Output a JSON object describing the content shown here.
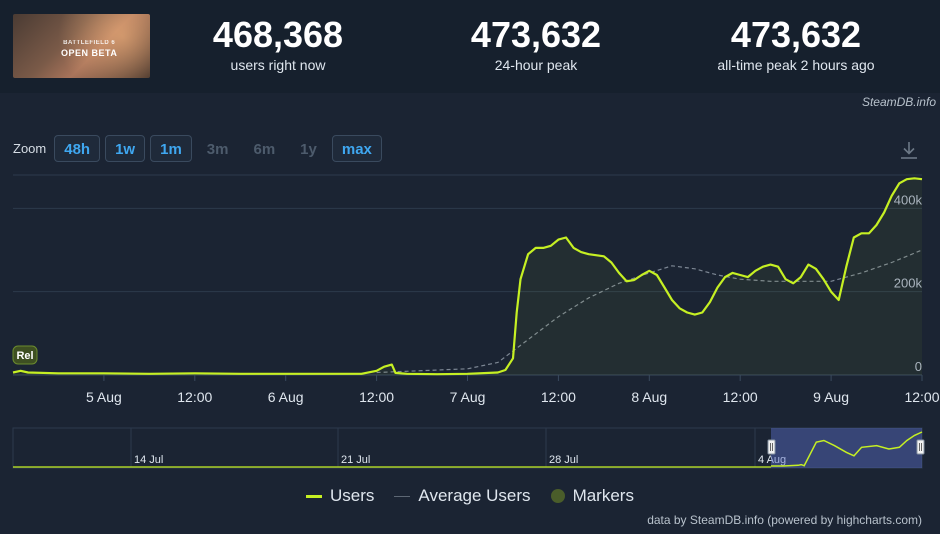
{
  "header": {
    "banner": {
      "line1": "BATTLEFIELD 6",
      "line2": "OPEN BETA"
    },
    "stats": [
      {
        "value": "468,368",
        "label": "users right now"
      },
      {
        "value": "473,632",
        "label": "24-hour peak"
      },
      {
        "value": "473,632",
        "label": "all-time peak 2 hours ago"
      }
    ],
    "credit": "SteamDB.info"
  },
  "zoom": {
    "label": "Zoom",
    "buttons": [
      {
        "label": "48h",
        "enabled": true
      },
      {
        "label": "1w",
        "enabled": true
      },
      {
        "label": "1m",
        "enabled": true
      },
      {
        "label": "3m",
        "enabled": false
      },
      {
        "label": "6m",
        "enabled": false
      },
      {
        "label": "1y",
        "enabled": false
      },
      {
        "label": "max",
        "enabled": true
      }
    ]
  },
  "icons": {
    "download": "download-icon"
  },
  "colors": {
    "users": "#c6f023",
    "average": "#7d8794",
    "markers": "#4a5d2a"
  },
  "chart_data": {
    "type": "line",
    "title": "",
    "x_unit": "hours since 4 Aug 00:00 UTC",
    "x_range": [
      12,
      132
    ],
    "x_ticks": [
      {
        "x": 24,
        "label": "5 Aug"
      },
      {
        "x": 36,
        "label": "12:00"
      },
      {
        "x": 48,
        "label": "6 Aug"
      },
      {
        "x": 60,
        "label": "12:00"
      },
      {
        "x": 72,
        "label": "7 Aug"
      },
      {
        "x": 84,
        "label": "12:00"
      },
      {
        "x": 96,
        "label": "8 Aug"
      },
      {
        "x": 108,
        "label": "12:00"
      },
      {
        "x": 120,
        "label": "9 Aug"
      },
      {
        "x": 132,
        "label": "12:00"
      }
    ],
    "y_range": [
      0,
      480000
    ],
    "y_ticks": [
      {
        "value": 0,
        "label": "0"
      },
      {
        "value": 200000,
        "label": "200k"
      },
      {
        "value": 400000,
        "label": "400k"
      }
    ],
    "grid": true,
    "legend_position": "bottom-center",
    "series": [
      {
        "name": "Users",
        "color": "#c6f023",
        "points": [
          [
            12,
            6000
          ],
          [
            13,
            10000
          ],
          [
            14,
            6000
          ],
          [
            18,
            4000
          ],
          [
            24,
            4000
          ],
          [
            30,
            3000
          ],
          [
            36,
            4000
          ],
          [
            42,
            3000
          ],
          [
            48,
            3000
          ],
          [
            54,
            3000
          ],
          [
            58,
            3000
          ],
          [
            60,
            10000
          ],
          [
            61,
            20000
          ],
          [
            62,
            25000
          ],
          [
            62.5,
            5000
          ],
          [
            64,
            3000
          ],
          [
            68,
            2000
          ],
          [
            72,
            3000
          ],
          [
            76,
            6000
          ],
          [
            77,
            12000
          ],
          [
            78,
            40000
          ],
          [
            78.5,
            150000
          ],
          [
            79,
            230000
          ],
          [
            80,
            290000
          ],
          [
            81,
            305000
          ],
          [
            82,
            305000
          ],
          [
            83,
            310000
          ],
          [
            84,
            325000
          ],
          [
            85,
            330000
          ],
          [
            86,
            305000
          ],
          [
            87,
            295000
          ],
          [
            88,
            290000
          ],
          [
            90,
            285000
          ],
          [
            91,
            270000
          ],
          [
            92,
            245000
          ],
          [
            93,
            225000
          ],
          [
            94,
            228000
          ],
          [
            95,
            240000
          ],
          [
            96,
            250000
          ],
          [
            97,
            240000
          ],
          [
            98,
            210000
          ],
          [
            99,
            180000
          ],
          [
            100,
            160000
          ],
          [
            101,
            150000
          ],
          [
            102,
            145000
          ],
          [
            103,
            150000
          ],
          [
            104,
            175000
          ],
          [
            105,
            210000
          ],
          [
            106,
            235000
          ],
          [
            107,
            245000
          ],
          [
            108,
            240000
          ],
          [
            109,
            235000
          ],
          [
            110,
            250000
          ],
          [
            111,
            260000
          ],
          [
            112,
            265000
          ],
          [
            113,
            260000
          ],
          [
            114,
            230000
          ],
          [
            115,
            220000
          ],
          [
            116,
            235000
          ],
          [
            117,
            265000
          ],
          [
            118,
            255000
          ],
          [
            119,
            230000
          ],
          [
            120,
            200000
          ],
          [
            121,
            180000
          ],
          [
            122,
            260000
          ],
          [
            123,
            330000
          ],
          [
            124,
            340000
          ],
          [
            125,
            340000
          ],
          [
            126,
            360000
          ],
          [
            127,
            390000
          ],
          [
            128,
            430000
          ],
          [
            129,
            460000
          ],
          [
            130,
            470000
          ],
          [
            131,
            472000
          ],
          [
            132,
            470000
          ]
        ]
      },
      {
        "name": "Average Users",
        "color": "#7d8794",
        "points": [
          [
            60,
            6000
          ],
          [
            72,
            15000
          ],
          [
            76,
            30000
          ],
          [
            80,
            85000
          ],
          [
            84,
            140000
          ],
          [
            88,
            185000
          ],
          [
            92,
            220000
          ],
          [
            96,
            245000
          ],
          [
            99,
            262000
          ],
          [
            102,
            255000
          ],
          [
            105,
            240000
          ],
          [
            108,
            230000
          ],
          [
            112,
            225000
          ],
          [
            116,
            225000
          ],
          [
            120,
            225000
          ],
          [
            124,
            245000
          ],
          [
            128,
            270000
          ],
          [
            132,
            300000
          ]
        ]
      },
      {
        "name": "Markers",
        "color": "#4a5d2a",
        "markers": [
          {
            "x": 12,
            "label": "Rel"
          }
        ]
      }
    ],
    "navigator": {
      "x_ticks": [
        "14 Jul",
        "21 Jul",
        "28 Jul",
        "4 Aug"
      ],
      "profile": [
        [
          0.0,
          0.0
        ],
        [
          0.08,
          0.0
        ],
        [
          0.18,
          0.02
        ],
        [
          0.2,
          0.04
        ],
        [
          0.22,
          0.01
        ],
        [
          0.3,
          0.7
        ],
        [
          0.35,
          0.75
        ],
        [
          0.42,
          0.6
        ],
        [
          0.5,
          0.4
        ],
        [
          0.55,
          0.3
        ],
        [
          0.6,
          0.55
        ],
        [
          0.7,
          0.6
        ],
        [
          0.78,
          0.5
        ],
        [
          0.85,
          0.55
        ],
        [
          0.9,
          0.75
        ],
        [
          0.95,
          0.9
        ],
        [
          1.0,
          1.0
        ]
      ]
    }
  },
  "legend": [
    {
      "name": "Users",
      "kind": "line",
      "color": "#c6f023"
    },
    {
      "name": "Average Users",
      "kind": "line",
      "color": "#7d8794"
    },
    {
      "name": "Markers",
      "kind": "dot",
      "color": "#4a5d2a"
    }
  ],
  "footer_credit": "data by SteamDB.info (powered by highcharts.com)"
}
